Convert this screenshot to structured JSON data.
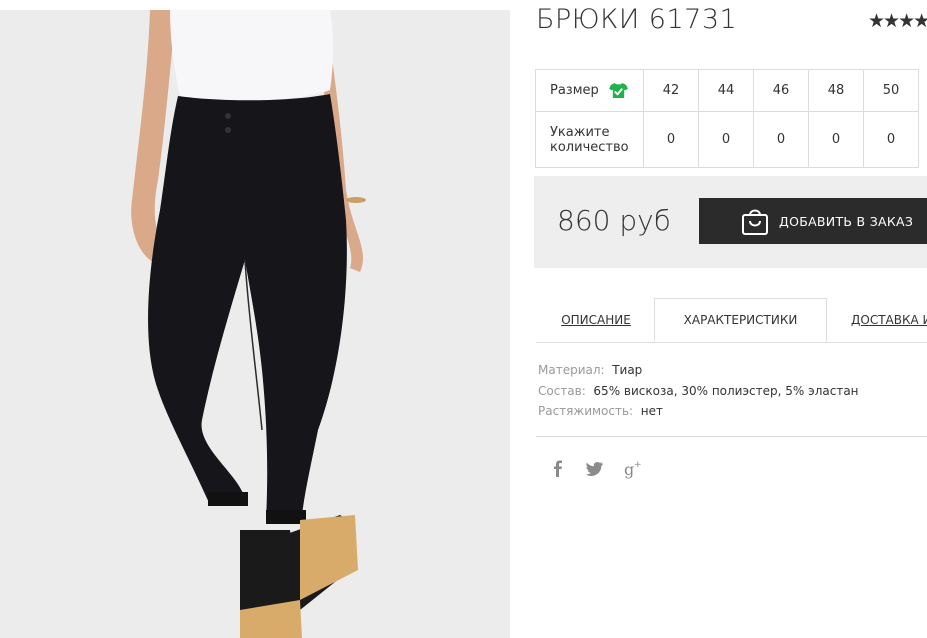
{
  "product": {
    "title": "БРЮКИ 61731",
    "rating_stars": "★★★★★"
  },
  "sizes": {
    "size_label": "Размер",
    "qty_label_line1": "Укажите",
    "qty_label_line2": "количество",
    "columns": [
      "42",
      "44",
      "46",
      "48",
      "50"
    ],
    "quantities": [
      "0",
      "0",
      "0",
      "0",
      "0"
    ],
    "icon": "shirt-check-icon",
    "icon_color": "#22b24c"
  },
  "purchase": {
    "price": "860 руб",
    "add_button_label": "ДОБАВИТЬ В ЗАКАЗ",
    "add_button_icon": "shopping-bag-icon"
  },
  "tabs": [
    {
      "label": "ОПИСАНИЕ",
      "active": false
    },
    {
      "label": "ХАРАКТЕРИСТИКИ",
      "active": true
    },
    {
      "label": "ДОСТАВКА И ОПЛАТА",
      "active": false
    }
  ],
  "characteristics": [
    {
      "key": "Материал:",
      "value": "Тиар"
    },
    {
      "key": "Состав:",
      "value": "65% вискоза, 30% полиэстер, 5% эластан"
    },
    {
      "key": "Растяжимость:",
      "value": "нет"
    }
  ],
  "social": [
    {
      "icon": "facebook-icon",
      "glyph": "f"
    },
    {
      "icon": "twitter-icon",
      "glyph": "🐦"
    },
    {
      "icon": "google-plus-icon",
      "glyph": "g+"
    }
  ],
  "colors": {
    "button_bg": "#2b2b2b",
    "price_bar_bg": "#eeeeee",
    "accent_green": "#22b24c"
  }
}
